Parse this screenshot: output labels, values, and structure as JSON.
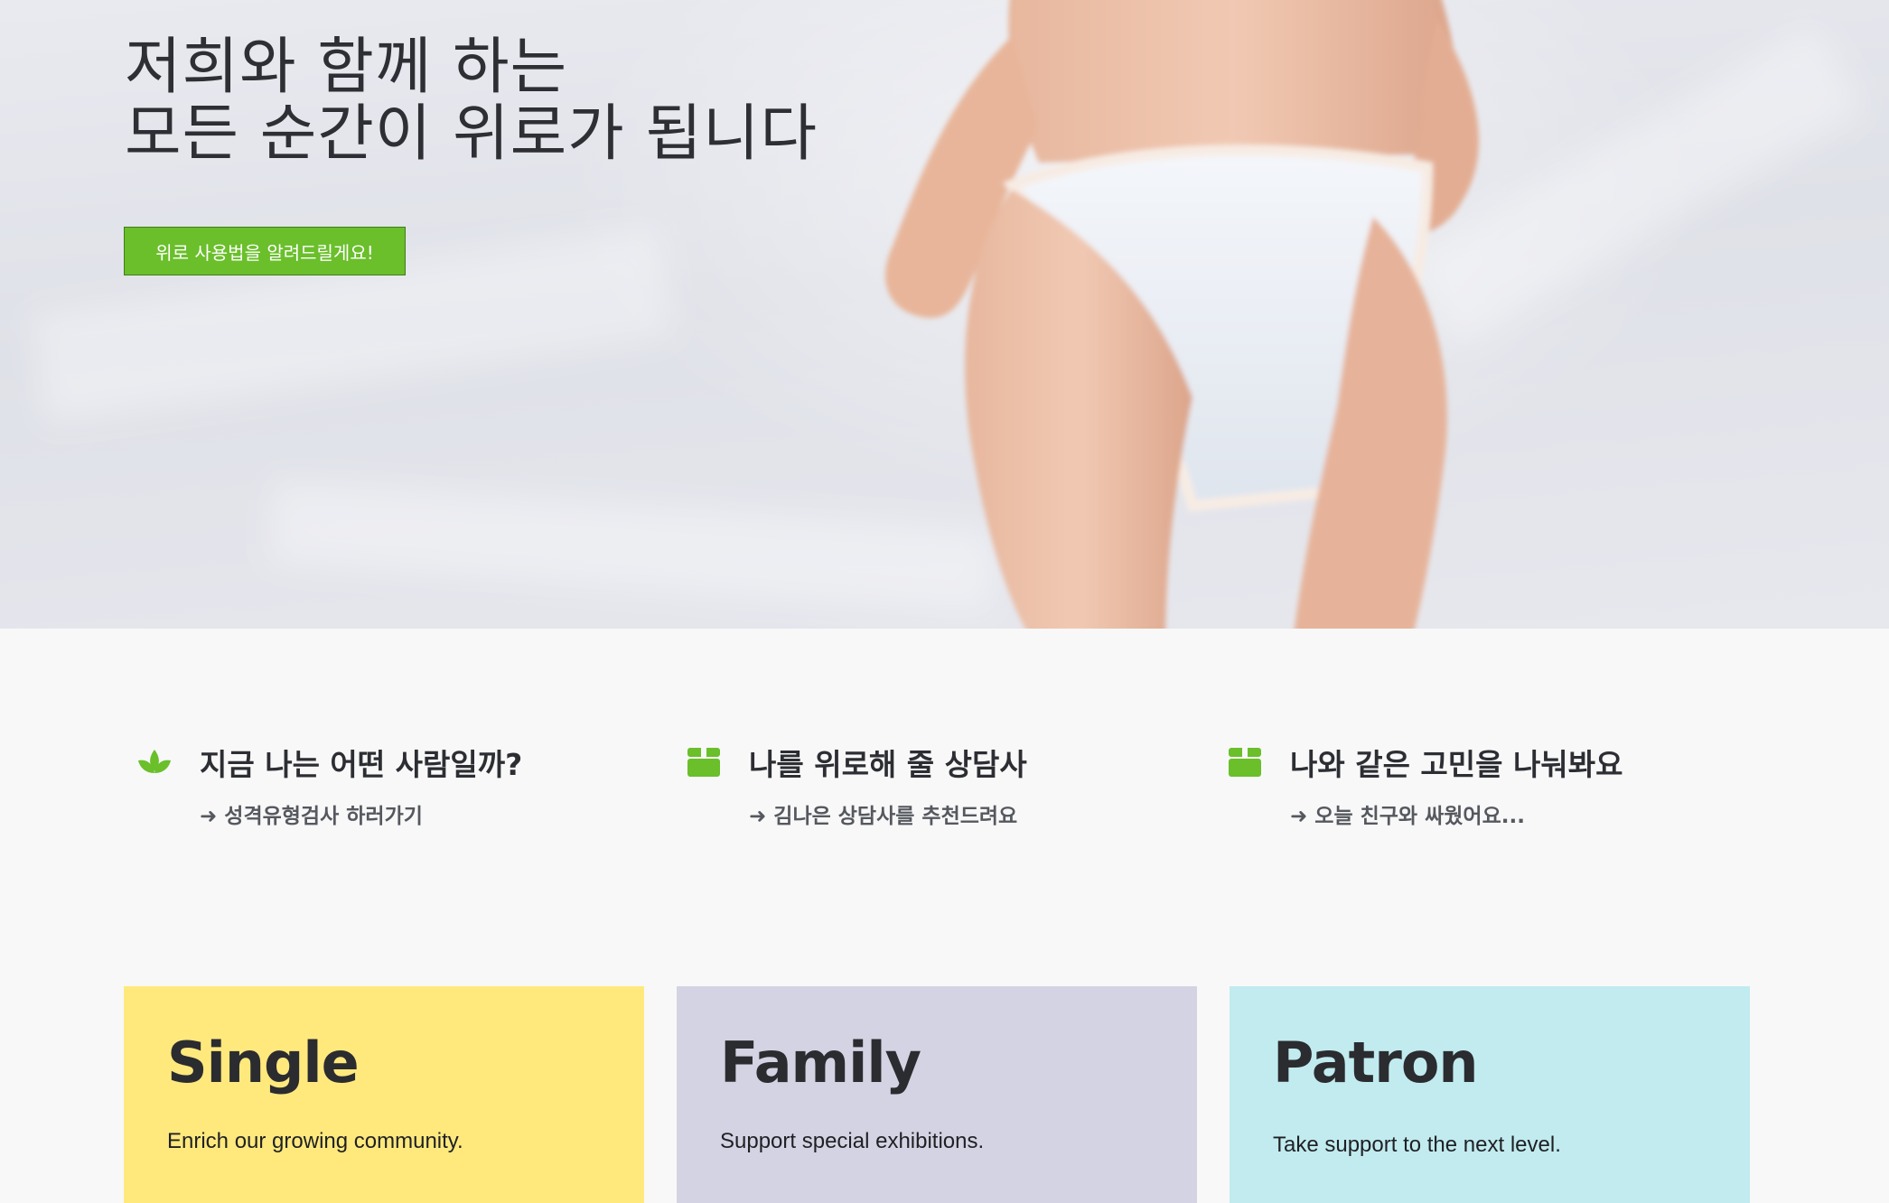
{
  "hero": {
    "title_line1": "저희와 함께 하는",
    "title_line2": "모든 순간이 위로가 됩니다",
    "button_label": "위로 사용법을 알려드릴게요!",
    "button_color": "#6abf2b"
  },
  "features": [
    {
      "icon": "leaf-icon",
      "title": "지금 나는 어떤 사람일까?",
      "link": "➜ 성격유형검사 하러가기"
    },
    {
      "icon": "box-icon",
      "title": "나를 위로해 줄 상담사",
      "link": "➜ 김나은 상담사를 추천드려요"
    },
    {
      "icon": "box-icon",
      "title": "나와 같은 고민을 나눠봐요",
      "link": "➜ 오늘 친구와 싸웠어요..."
    }
  ],
  "cards": [
    {
      "title": "Single",
      "description": "Enrich our growing community.",
      "color": "#ffe97d"
    },
    {
      "title": "Family",
      "description": "Support special exhibitions.",
      "color": "#d4d3e3"
    },
    {
      "title": "Patron",
      "description": "Take support to the next level.",
      "color": "#c1ebef"
    }
  ],
  "accent_color": "#6abf2b"
}
